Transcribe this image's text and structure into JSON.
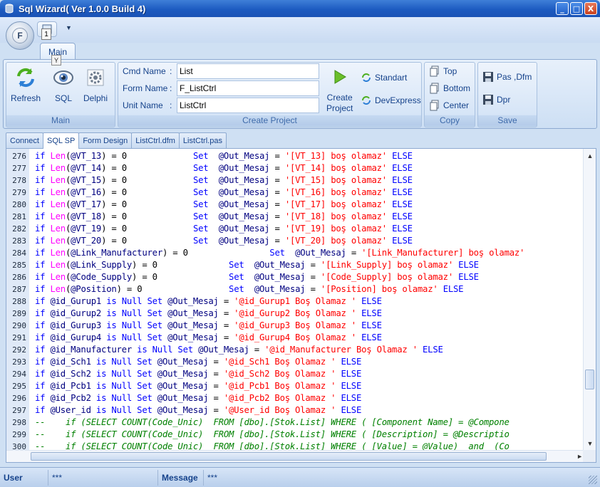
{
  "window": {
    "title": "Sql Wizard( Ver 1.0.0 Build 4)",
    "controls": [
      "_",
      "□",
      "X"
    ]
  },
  "app_button": {
    "label": "F"
  },
  "qat": {
    "badge": "1",
    "tooltip_key": "Y"
  },
  "ribbon": {
    "tab": "Main",
    "groups": {
      "main": {
        "label": "Main",
        "buttons": [
          "Refresh",
          "SQL",
          "Delphi"
        ]
      },
      "create_project": {
        "label": "Create Project",
        "fields": [
          {
            "label": "Cmd Name",
            "value": "List"
          },
          {
            "label": "Form Name",
            "value": "F_ListCtrl"
          },
          {
            "label": "Unit Name",
            "value": "ListCtrl"
          }
        ],
        "create_button": [
          "Create",
          "Project"
        ],
        "options": [
          "Standart",
          "DevExpress"
        ]
      },
      "copy": {
        "label": "Copy",
        "buttons": [
          "Top",
          "Bottom",
          "Center"
        ]
      },
      "save": {
        "label": "Save",
        "buttons": [
          "Pas ,Dfm",
          "Dpr"
        ]
      }
    }
  },
  "doc_tabs": [
    "Connect",
    "SQL SP",
    "Form Design",
    "ListCtrl.dfm",
    "ListCtrl.pas"
  ],
  "active_doc_tab": "SQL SP",
  "editor": {
    "lines": [
      {
        "n": "276",
        "tokens": [
          [
            "kw",
            "if "
          ],
          [
            "fn",
            "Len"
          ],
          [
            "pl",
            "("
          ],
          [
            "id",
            "@VT_13"
          ],
          [
            "pl",
            ") = 0             "
          ],
          [
            "kw",
            "Set"
          ],
          [
            "pl",
            "  "
          ],
          [
            "id",
            "@Out_Mesaj"
          ],
          [
            "pl",
            " = "
          ],
          [
            "str",
            "'[VT_13] boş olamaz'"
          ],
          [
            "kw",
            " ELSE"
          ]
        ]
      },
      {
        "n": "277",
        "tokens": [
          [
            "kw",
            "if "
          ],
          [
            "fn",
            "Len"
          ],
          [
            "pl",
            "("
          ],
          [
            "id",
            "@VT_14"
          ],
          [
            "pl",
            ") = 0             "
          ],
          [
            "kw",
            "Set"
          ],
          [
            "pl",
            "  "
          ],
          [
            "id",
            "@Out_Mesaj"
          ],
          [
            "pl",
            " = "
          ],
          [
            "str",
            "'[VT_14] boş olamaz'"
          ],
          [
            "kw",
            " ELSE"
          ]
        ]
      },
      {
        "n": "278",
        "tokens": [
          [
            "kw",
            "if "
          ],
          [
            "fn",
            "Len"
          ],
          [
            "pl",
            "("
          ],
          [
            "id",
            "@VT_15"
          ],
          [
            "pl",
            ") = 0             "
          ],
          [
            "kw",
            "Set"
          ],
          [
            "pl",
            "  "
          ],
          [
            "id",
            "@Out_Mesaj"
          ],
          [
            "pl",
            " = "
          ],
          [
            "str",
            "'[VT_15] boş olamaz'"
          ],
          [
            "kw",
            " ELSE"
          ]
        ]
      },
      {
        "n": "279",
        "tokens": [
          [
            "kw",
            "if "
          ],
          [
            "fn",
            "Len"
          ],
          [
            "pl",
            "("
          ],
          [
            "id",
            "@VT_16"
          ],
          [
            "pl",
            ") = 0             "
          ],
          [
            "kw",
            "Set"
          ],
          [
            "pl",
            "  "
          ],
          [
            "id",
            "@Out_Mesaj"
          ],
          [
            "pl",
            " = "
          ],
          [
            "str",
            "'[VT_16] boş olamaz'"
          ],
          [
            "kw",
            " ELSE"
          ]
        ]
      },
      {
        "n": "280",
        "tokens": [
          [
            "kw",
            "if "
          ],
          [
            "fn",
            "Len"
          ],
          [
            "pl",
            "("
          ],
          [
            "id",
            "@VT_17"
          ],
          [
            "pl",
            ") = 0             "
          ],
          [
            "kw",
            "Set"
          ],
          [
            "pl",
            "  "
          ],
          [
            "id",
            "@Out_Mesaj"
          ],
          [
            "pl",
            " = "
          ],
          [
            "str",
            "'[VT_17] boş olamaz'"
          ],
          [
            "kw",
            " ELSE"
          ]
        ]
      },
      {
        "n": "281",
        "tokens": [
          [
            "kw",
            "if "
          ],
          [
            "fn",
            "Len"
          ],
          [
            "pl",
            "("
          ],
          [
            "id",
            "@VT_18"
          ],
          [
            "pl",
            ") = 0             "
          ],
          [
            "kw",
            "Set"
          ],
          [
            "pl",
            "  "
          ],
          [
            "id",
            "@Out_Mesaj"
          ],
          [
            "pl",
            " = "
          ],
          [
            "str",
            "'[VT_18] boş olamaz'"
          ],
          [
            "kw",
            " ELSE"
          ]
        ]
      },
      {
        "n": "282",
        "tokens": [
          [
            "kw",
            "if "
          ],
          [
            "fn",
            "Len"
          ],
          [
            "pl",
            "("
          ],
          [
            "id",
            "@VT_19"
          ],
          [
            "pl",
            ") = 0             "
          ],
          [
            "kw",
            "Set"
          ],
          [
            "pl",
            "  "
          ],
          [
            "id",
            "@Out_Mesaj"
          ],
          [
            "pl",
            " = "
          ],
          [
            "str",
            "'[VT_19] boş olamaz'"
          ],
          [
            "kw",
            " ELSE"
          ]
        ]
      },
      {
        "n": "283",
        "tokens": [
          [
            "kw",
            "if "
          ],
          [
            "fn",
            "Len"
          ],
          [
            "pl",
            "("
          ],
          [
            "id",
            "@VT_20"
          ],
          [
            "pl",
            ") = 0             "
          ],
          [
            "kw",
            "Set"
          ],
          [
            "pl",
            "  "
          ],
          [
            "id",
            "@Out_Mesaj"
          ],
          [
            "pl",
            " = "
          ],
          [
            "str",
            "'[VT_20] boş olamaz'"
          ],
          [
            "kw",
            " ELSE"
          ]
        ]
      },
      {
        "n": "284",
        "tokens": [
          [
            "kw",
            "if "
          ],
          [
            "fn",
            "Len"
          ],
          [
            "pl",
            "("
          ],
          [
            "id",
            "@Link_Manufacturer"
          ],
          [
            "pl",
            ") = 0                "
          ],
          [
            "kw",
            "Set"
          ],
          [
            "pl",
            "  "
          ],
          [
            "id",
            "@Out_Mesaj"
          ],
          [
            "pl",
            " = "
          ],
          [
            "str",
            "'[Link_Manufacturer] boş olamaz'"
          ]
        ]
      },
      {
        "n": "285",
        "tokens": [
          [
            "kw",
            "if "
          ],
          [
            "fn",
            "Len"
          ],
          [
            "pl",
            "("
          ],
          [
            "id",
            "@Link_Supply"
          ],
          [
            "pl",
            ") = 0              "
          ],
          [
            "kw",
            "Set"
          ],
          [
            "pl",
            "  "
          ],
          [
            "id",
            "@Out_Mesaj"
          ],
          [
            "pl",
            " = "
          ],
          [
            "str",
            "'[Link_Supply] boş olamaz'"
          ],
          [
            "kw",
            " ELSE"
          ]
        ]
      },
      {
        "n": "286",
        "tokens": [
          [
            "kw",
            "if "
          ],
          [
            "fn",
            "Len"
          ],
          [
            "pl",
            "("
          ],
          [
            "id",
            "@Code_Supply"
          ],
          [
            "pl",
            ") = 0              "
          ],
          [
            "kw",
            "Set"
          ],
          [
            "pl",
            "  "
          ],
          [
            "id",
            "@Out_Mesaj"
          ],
          [
            "pl",
            " = "
          ],
          [
            "str",
            "'[Code_Supply] boş olamaz'"
          ],
          [
            "kw",
            " ELSE"
          ]
        ]
      },
      {
        "n": "287",
        "tokens": [
          [
            "kw",
            "if "
          ],
          [
            "fn",
            "Len"
          ],
          [
            "pl",
            "("
          ],
          [
            "id",
            "@Position"
          ],
          [
            "pl",
            ") = 0                 "
          ],
          [
            "kw",
            "Set"
          ],
          [
            "pl",
            "  "
          ],
          [
            "id",
            "@Out_Mesaj"
          ],
          [
            "pl",
            " = "
          ],
          [
            "str",
            "'[Position] boş olamaz'"
          ],
          [
            "kw",
            " ELSE"
          ]
        ]
      },
      {
        "n": "288",
        "tokens": [
          [
            "kw",
            "if "
          ],
          [
            "id",
            "@id_Gurup1"
          ],
          [
            "kw",
            " is Null Set "
          ],
          [
            "id",
            "@Out_Mesaj"
          ],
          [
            "pl",
            " = "
          ],
          [
            "str",
            "'@id_Gurup1 Boş Olamaz '"
          ],
          [
            "kw",
            " ELSE"
          ]
        ]
      },
      {
        "n": "289",
        "tokens": [
          [
            "kw",
            "if "
          ],
          [
            "id",
            "@id_Gurup2"
          ],
          [
            "kw",
            " is Null Set "
          ],
          [
            "id",
            "@Out_Mesaj"
          ],
          [
            "pl",
            " = "
          ],
          [
            "str",
            "'@id_Gurup2 Boş Olamaz '"
          ],
          [
            "kw",
            " ELSE"
          ]
        ]
      },
      {
        "n": "290",
        "tokens": [
          [
            "kw",
            "if "
          ],
          [
            "id",
            "@id_Gurup3"
          ],
          [
            "kw",
            " is Null Set "
          ],
          [
            "id",
            "@Out_Mesaj"
          ],
          [
            "pl",
            " = "
          ],
          [
            "str",
            "'@id_Gurup3 Boş Olamaz '"
          ],
          [
            "kw",
            " ELSE"
          ]
        ]
      },
      {
        "n": "291",
        "tokens": [
          [
            "kw",
            "if "
          ],
          [
            "id",
            "@id_Gurup4"
          ],
          [
            "kw",
            " is Null Set "
          ],
          [
            "id",
            "@Out_Mesaj"
          ],
          [
            "pl",
            " = "
          ],
          [
            "str",
            "'@id_Gurup4 Boş Olamaz '"
          ],
          [
            "kw",
            " ELSE"
          ]
        ]
      },
      {
        "n": "292",
        "tokens": [
          [
            "kw",
            "if "
          ],
          [
            "id",
            "@id_Manufacturer"
          ],
          [
            "kw",
            " is Null Set "
          ],
          [
            "id",
            "@Out_Mesaj"
          ],
          [
            "pl",
            " = "
          ],
          [
            "str",
            "'@id_Manufacturer Boş Olamaz '"
          ],
          [
            "kw",
            " ELSE"
          ]
        ]
      },
      {
        "n": "293",
        "tokens": [
          [
            "kw",
            "if "
          ],
          [
            "id",
            "@id_Sch1"
          ],
          [
            "kw",
            " is Null Set "
          ],
          [
            "id",
            "@Out_Mesaj"
          ],
          [
            "pl",
            " = "
          ],
          [
            "str",
            "'@id_Sch1 Boş Olamaz '"
          ],
          [
            "kw",
            " ELSE"
          ]
        ]
      },
      {
        "n": "294",
        "tokens": [
          [
            "kw",
            "if "
          ],
          [
            "id",
            "@id_Sch2"
          ],
          [
            "kw",
            " is Null Set "
          ],
          [
            "id",
            "@Out_Mesaj"
          ],
          [
            "pl",
            " = "
          ],
          [
            "str",
            "'@id_Sch2 Boş Olamaz '"
          ],
          [
            "kw",
            " ELSE"
          ]
        ]
      },
      {
        "n": "295",
        "tokens": [
          [
            "kw",
            "if "
          ],
          [
            "id",
            "@id_Pcb1"
          ],
          [
            "kw",
            " is Null Set "
          ],
          [
            "id",
            "@Out_Mesaj"
          ],
          [
            "pl",
            " = "
          ],
          [
            "str",
            "'@id_Pcb1 Boş Olamaz '"
          ],
          [
            "kw",
            " ELSE"
          ]
        ]
      },
      {
        "n": "296",
        "tokens": [
          [
            "kw",
            "if "
          ],
          [
            "id",
            "@id_Pcb2"
          ],
          [
            "kw",
            " is Null Set "
          ],
          [
            "id",
            "@Out_Mesaj"
          ],
          [
            "pl",
            " = "
          ],
          [
            "str",
            "'@id_Pcb2 Boş Olamaz '"
          ],
          [
            "kw",
            " ELSE"
          ]
        ]
      },
      {
        "n": "297",
        "tokens": [
          [
            "kw",
            "if "
          ],
          [
            "id",
            "@User_id"
          ],
          [
            "kw",
            " is Null Set "
          ],
          [
            "id",
            "@Out_Mesaj"
          ],
          [
            "pl",
            " = "
          ],
          [
            "str",
            "'@User_id Boş Olamaz '"
          ],
          [
            "kw",
            " ELSE"
          ]
        ]
      },
      {
        "n": "298",
        "tokens": [
          [
            "cm",
            "--    if (SELECT COUNT(Code_Unic)  FROM [dbo].[Stok.List] WHERE ( [Component Name] = @Compone"
          ]
        ]
      },
      {
        "n": "299",
        "tokens": [
          [
            "cm",
            "--    if (SELECT COUNT(Code_Unic)  FROM [dbo].[Stok.List] WHERE ( [Description] = @Descriptio"
          ]
        ]
      },
      {
        "n": "300",
        "tokens": [
          [
            "cm",
            "--    if (SELECT COUNT(Code_Unic)  FROM [dbo].[Stok.List] WHERE ( [Value] = @Value)  and  (Co"
          ]
        ]
      }
    ]
  },
  "statusbar": {
    "user_label": "User",
    "user_value": "***",
    "message_label": "Message",
    "message_value": "***"
  }
}
